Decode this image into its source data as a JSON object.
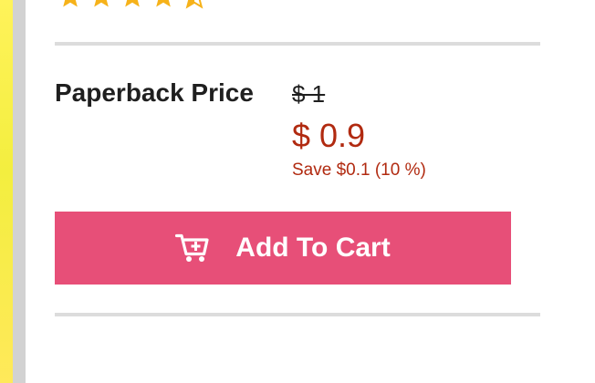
{
  "product": {
    "rating": 4.5,
    "rating_max": 5,
    "price_label": "Paperback Price",
    "old_price": "$ 1",
    "sale_price": "$ 0.9",
    "save_text": "Save $0.1 (10 %)"
  },
  "actions": {
    "add_to_cart_label": "Add To Cart"
  },
  "colors": {
    "accent_pink": "#e74f78",
    "price_red": "#b12a10",
    "star_gold": "#f6b21a",
    "text_dark": "#1f1f1f",
    "divider_gray": "#dcdcdc"
  },
  "icons": {
    "cart": "cart-plus-icon",
    "star": "star-icon"
  }
}
